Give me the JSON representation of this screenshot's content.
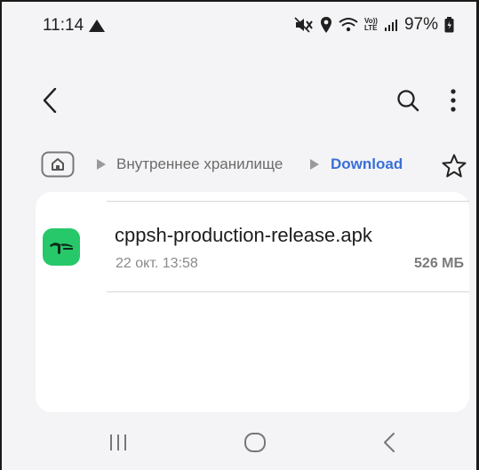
{
  "status_bar": {
    "time": "11:14",
    "volte_top": "Vo))",
    "volte_bottom": "LTE",
    "battery": "97%"
  },
  "app_bar": {
    "back_icon": "back-arrow-icon",
    "search_icon": "search-icon",
    "more_icon": "more-vertical-icon"
  },
  "breadcrumb": {
    "home_icon": "home-folder-icon",
    "internal_storage": "Внутреннее хранилище",
    "current_folder": "Download",
    "star_icon": "star-outline-icon",
    "current_color": "#3a6fd6"
  },
  "files": [
    {
      "name": "cppsh-production-release.apk",
      "date": "22 окт. 13:58",
      "size": "526 МБ",
      "icon_color": "#27c86a"
    }
  ],
  "nav_bar": {
    "recents_icon": "recents-icon",
    "home_icon": "home-circle-icon",
    "back_icon": "back-chevron-icon"
  }
}
